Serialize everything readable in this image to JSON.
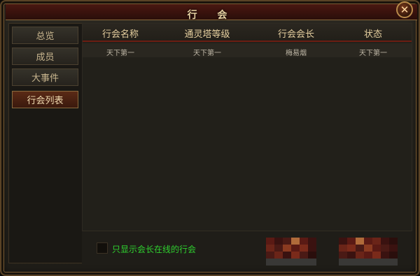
{
  "window": {
    "title": "行 会",
    "close_label": "✕"
  },
  "sidebar": {
    "items": [
      {
        "label": "总览",
        "active": false
      },
      {
        "label": "成员",
        "active": false
      },
      {
        "label": "大事件",
        "active": false
      },
      {
        "label": "行会列表",
        "active": true
      }
    ]
  },
  "table": {
    "headers": [
      "行会名称",
      "通灵塔等级",
      "行会会长",
      "状态"
    ],
    "rows": [
      [
        "天下第一",
        "天下第一",
        "梅易烟",
        "天下第一"
      ]
    ]
  },
  "footer": {
    "checkbox_label": "只显示会长在线的行会",
    "checkbox_checked": false
  },
  "colors": {
    "accent_red": "#6b1d12",
    "gold": "#e5cf9f",
    "green_text": "#2fd12f"
  }
}
